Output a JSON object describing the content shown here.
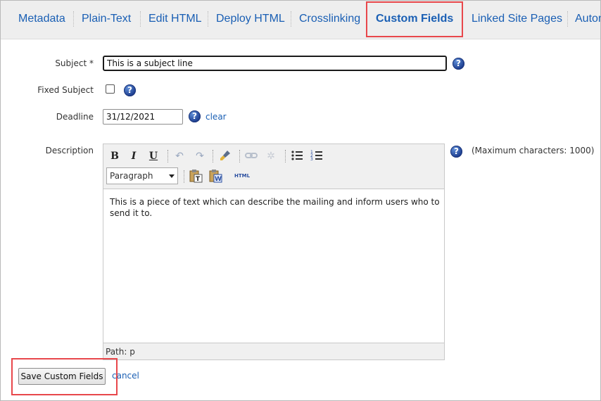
{
  "tabs": [
    {
      "label": "Metadata",
      "active": false
    },
    {
      "label": "Plain-Text",
      "active": false
    },
    {
      "label": "Edit HTML",
      "active": false
    },
    {
      "label": "Deploy HTML",
      "active": false
    },
    {
      "label": "Crosslinking",
      "active": false
    },
    {
      "label": "Custom Fields",
      "active": true
    },
    {
      "label": "Linked Site Pages",
      "active": false
    },
    {
      "label": "Autom",
      "active": false
    }
  ],
  "form": {
    "subject": {
      "label": "Subject *",
      "value": "This is a subject line"
    },
    "fixed_subject": {
      "label": "Fixed Subject",
      "checked": false
    },
    "deadline": {
      "label": "Deadline",
      "value": "31/12/2021",
      "clear_label": "clear"
    },
    "description": {
      "label": "Description",
      "max_chars_note": "(Maximum characters: 1000)",
      "format_select": "Paragraph",
      "html_button": "HTML",
      "text": "This is a piece of text which can describe the mailing and inform users who to send it to.",
      "path": "Path: p"
    }
  },
  "actions": {
    "save_label": "Save Custom Fields",
    "cancel_label": "cancel"
  },
  "colors": {
    "accent": "#1a5fb4",
    "highlight": "#e8474b",
    "tabbar_bg": "#eeeeee"
  },
  "icons": [
    "help-icon",
    "bold-icon",
    "italic-icon",
    "underline-icon",
    "undo-icon",
    "redo-icon",
    "cleanup-icon",
    "link-icon",
    "unlink-icon",
    "bullet-list-icon",
    "numbered-list-icon",
    "paste-text-icon",
    "paste-word-icon",
    "html-source-icon"
  ]
}
